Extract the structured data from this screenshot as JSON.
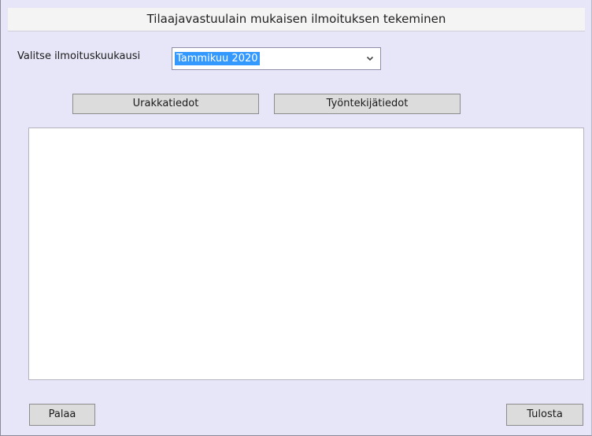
{
  "window": {
    "title": "Tilaajavastuulain mukaisen ilmoituksen tekeminen"
  },
  "month_picker": {
    "label": "Valitse ilmoituskuukausi",
    "selected": "Tammikuu 2020",
    "icon": "chevron-down-icon"
  },
  "toolbar": {
    "urakkatiedot_label": "Urakkatiedot",
    "tyontekijatiedot_label": "Työntekijätiedot"
  },
  "footer": {
    "palaa_label": "Palaa",
    "tulosta_label": "Tulosta"
  },
  "colors": {
    "background": "#e6e6f8",
    "selection": "#3399ff",
    "button": "#dcdcdc"
  }
}
